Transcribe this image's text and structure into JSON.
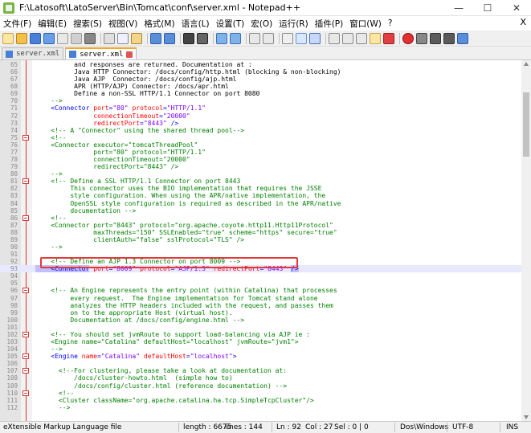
{
  "window": {
    "title": "F:\\Latosoft\\LatoServer\\Bin\\Tomcat\\conf\\server.xml - Notepad++",
    "minimize": "—",
    "maximize": "☐",
    "close": "✕"
  },
  "menu": {
    "items": [
      "文件(F)",
      "编辑(E)",
      "搜索(S)",
      "视图(V)",
      "格式(M)",
      "语言(L)",
      "设置(T)",
      "宏(O)",
      "运行(R)",
      "插件(P)",
      "窗口(W)",
      "?"
    ],
    "close": "X"
  },
  "tabs": [
    {
      "label": "server.xml",
      "active": false
    },
    {
      "label": "server.xml",
      "active": true
    }
  ],
  "editor": {
    "lines": [
      {
        "n": "65",
        "fold": false,
        "code": [
          [
            "",
            "          and responses are returned. Documentation at :"
          ]
        ]
      },
      {
        "n": "66",
        "fold": false,
        "code": [
          [
            "",
            "          Java HTTP Connector: /docs/config/http.html (blocking & non-blocking)"
          ]
        ]
      },
      {
        "n": "67",
        "fold": false,
        "code": [
          [
            "",
            "          Java AJP  Connector: /docs/config/ajp.html"
          ]
        ]
      },
      {
        "n": "68",
        "fold": false,
        "code": [
          [
            "",
            "          APR (HTTP/AJP) Connector: /docs/apr.html"
          ]
        ]
      },
      {
        "n": "69",
        "fold": false,
        "code": [
          [
            "",
            "          Define a non-SSL HTTP/1.1 Connector on port 8080"
          ]
        ]
      },
      {
        "n": "70",
        "fold": false,
        "code": [
          [
            "c",
            "    -->"
          ]
        ]
      },
      {
        "n": "71",
        "fold": false,
        "code": [
          [
            "t",
            "    <Connector "
          ],
          [
            "a",
            "port"
          ],
          [
            "t",
            "="
          ],
          [
            "v",
            "\"80\""
          ],
          [
            "t",
            " "
          ],
          [
            "a",
            "protocol"
          ],
          [
            "t",
            "="
          ],
          [
            "v",
            "\"HTTP/1.1\""
          ]
        ]
      },
      {
        "n": "72",
        "fold": false,
        "code": [
          [
            "a",
            "               connectionTimeout"
          ],
          [
            "t",
            "="
          ],
          [
            "v",
            "\"20000\""
          ]
        ]
      },
      {
        "n": "73",
        "fold": false,
        "code": [
          [
            "a",
            "               redirectPort"
          ],
          [
            "t",
            "="
          ],
          [
            "v",
            "\"8443\""
          ],
          [
            "t",
            " />"
          ]
        ]
      },
      {
        "n": "74",
        "fold": false,
        "code": [
          [
            "c",
            "    <!-- A \"Connector\" using the shared thread pool-->"
          ]
        ]
      },
      {
        "n": "75",
        "fold": true,
        "code": [
          [
            "c",
            "    <!--"
          ]
        ]
      },
      {
        "n": "76",
        "fold": false,
        "code": [
          [
            "c",
            "    <Connector executor=\"tomcatThreadPool\""
          ]
        ]
      },
      {
        "n": "77",
        "fold": false,
        "code": [
          [
            "c",
            "               port=\"80\" protocol=\"HTTP/1.1\""
          ]
        ]
      },
      {
        "n": "78",
        "fold": false,
        "code": [
          [
            "c",
            "               connectionTimeout=\"20000\""
          ]
        ]
      },
      {
        "n": "79",
        "fold": false,
        "code": [
          [
            "c",
            "               redirectPort=\"8443\" />"
          ]
        ]
      },
      {
        "n": "80",
        "fold": false,
        "code": [
          [
            "c",
            "    -->"
          ]
        ]
      },
      {
        "n": "81",
        "fold": true,
        "code": [
          [
            "c",
            "    <!-- Define a SSL HTTP/1.1 Connector on port 8443"
          ]
        ]
      },
      {
        "n": "82",
        "fold": false,
        "code": [
          [
            "c",
            "         This connector uses the BIO implementation that requires the JSSE"
          ]
        ]
      },
      {
        "n": "83",
        "fold": false,
        "code": [
          [
            "c",
            "         style configuration. When using the APR/native implementation, the"
          ]
        ]
      },
      {
        "n": "84",
        "fold": false,
        "code": [
          [
            "c",
            "         OpenSSL style configuration is required as described in the APR/native"
          ]
        ]
      },
      {
        "n": "85",
        "fold": false,
        "code": [
          [
            "c",
            "         documentation -->"
          ]
        ]
      },
      {
        "n": "86",
        "fold": true,
        "code": [
          [
            "c",
            "    <!--"
          ]
        ]
      },
      {
        "n": "87",
        "fold": false,
        "code": [
          [
            "c",
            "    <Connector port=\"8443\" protocol=\"org.apache.coyote.http11.Http11Protocol\""
          ]
        ]
      },
      {
        "n": "88",
        "fold": false,
        "code": [
          [
            "c",
            "               maxThreads=\"150\" SSLEnabled=\"true\" scheme=\"https\" secure=\"true\""
          ]
        ]
      },
      {
        "n": "89",
        "fold": false,
        "code": [
          [
            "c",
            "               clientAuth=\"false\" sslProtocol=\"TLS\" />"
          ]
        ]
      },
      {
        "n": "90",
        "fold": false,
        "code": [
          [
            "c",
            "    -->"
          ]
        ]
      },
      {
        "n": "91",
        "fold": false,
        "code": [
          [
            "",
            ""
          ]
        ]
      },
      {
        "n": "92",
        "fold": false,
        "code": [
          [
            "c",
            "    <!-- Define an AJP 1.3 Connector on port 8009 -->"
          ]
        ]
      },
      {
        "n": "93",
        "fold": false,
        "hl": true,
        "code": [
          [
            "t sel",
            "    <Connector"
          ],
          [
            "t",
            " "
          ],
          [
            "a",
            "port"
          ],
          [
            "t",
            "="
          ],
          [
            "v",
            "\"8009\""
          ],
          [
            "t",
            " "
          ],
          [
            "a",
            "protocol"
          ],
          [
            "t",
            "="
          ],
          [
            "v",
            "\"AJP/1.3\""
          ],
          [
            "t",
            " "
          ],
          [
            "a",
            "redirectPort"
          ],
          [
            "t",
            "="
          ],
          [
            "v",
            "\"8443\""
          ],
          [
            "t",
            " "
          ],
          [
            "t sel",
            "/>"
          ]
        ]
      },
      {
        "n": "94",
        "fold": false,
        "code": [
          [
            "",
            ""
          ]
        ]
      },
      {
        "n": "95",
        "fold": false,
        "code": [
          [
            "",
            ""
          ]
        ]
      },
      {
        "n": "96",
        "fold": true,
        "code": [
          [
            "c",
            "    <!-- An Engine represents the entry point (within Catalina) that processes"
          ]
        ]
      },
      {
        "n": "97",
        "fold": false,
        "code": [
          [
            "c",
            "         every request.  The Engine implementation for Tomcat stand alone"
          ]
        ]
      },
      {
        "n": "98",
        "fold": false,
        "code": [
          [
            "c",
            "         analyzes the HTTP headers included with the request, and passes them"
          ]
        ]
      },
      {
        "n": "99",
        "fold": false,
        "code": [
          [
            "c",
            "         on to the appropriate Host (virtual host)."
          ]
        ]
      },
      {
        "n": "100",
        "fold": false,
        "code": [
          [
            "c",
            "         Documentation at /docs/config/engine.html -->"
          ]
        ]
      },
      {
        "n": "101",
        "fold": false,
        "code": [
          [
            "",
            ""
          ]
        ]
      },
      {
        "n": "102",
        "fold": true,
        "code": [
          [
            "c",
            "    <!-- You should set jvmRoute to support load-balancing via AJP ie :"
          ]
        ]
      },
      {
        "n": "103",
        "fold": false,
        "code": [
          [
            "c",
            "    <Engine name=\"Catalina\" defaultHost=\"localhost\" jvmRoute=\"jvm1\">"
          ]
        ]
      },
      {
        "n": "104",
        "fold": false,
        "code": [
          [
            "c",
            "    -->"
          ]
        ]
      },
      {
        "n": "105",
        "fold": true,
        "code": [
          [
            "t",
            "    <Engine "
          ],
          [
            "a",
            "name"
          ],
          [
            "t",
            "="
          ],
          [
            "v",
            "\"Catalina\""
          ],
          [
            "t",
            " "
          ],
          [
            "a",
            "defaultHost"
          ],
          [
            "t",
            "="
          ],
          [
            "v",
            "\"localhost\""
          ],
          [
            "t",
            ">"
          ]
        ]
      },
      {
        "n": "106",
        "fold": false,
        "code": [
          [
            "",
            ""
          ]
        ]
      },
      {
        "n": "107",
        "fold": true,
        "code": [
          [
            "c",
            "      <!--For clustering, please take a look at documentation at:"
          ]
        ]
      },
      {
        "n": "108",
        "fold": false,
        "code": [
          [
            "c",
            "          /docs/cluster-howto.html  (simple how to)"
          ]
        ]
      },
      {
        "n": "109",
        "fold": false,
        "code": [
          [
            "c",
            "          /docs/config/cluster.html (reference documentation) -->"
          ]
        ]
      },
      {
        "n": "110",
        "fold": true,
        "code": [
          [
            "c",
            "      <!--"
          ]
        ]
      },
      {
        "n": "111",
        "fold": false,
        "code": [
          [
            "c",
            "      <Cluster className=\"org.apache.catalina.ha.tcp.SimpleTcpCluster\"/>"
          ]
        ]
      },
      {
        "n": "112",
        "fold": false,
        "code": [
          [
            "c",
            "      -->"
          ]
        ]
      }
    ]
  },
  "status": {
    "filetype": "eXtensible Markup Language file",
    "length": "length : 6675",
    "lines": "lines : 144",
    "ln": "Ln : 92",
    "col": "Col : 27",
    "sel": "Sel : 0 | 0",
    "eol": "Dos\\Windows",
    "encoding": "UTF-8",
    "mode": "INS"
  },
  "colors": {
    "comment": "#008000",
    "tag": "#0000ff",
    "attribute": "#ff0000",
    "value": "#8000ff",
    "highlight_box": "#e53935",
    "active_tab_accent": "#f5a623"
  }
}
